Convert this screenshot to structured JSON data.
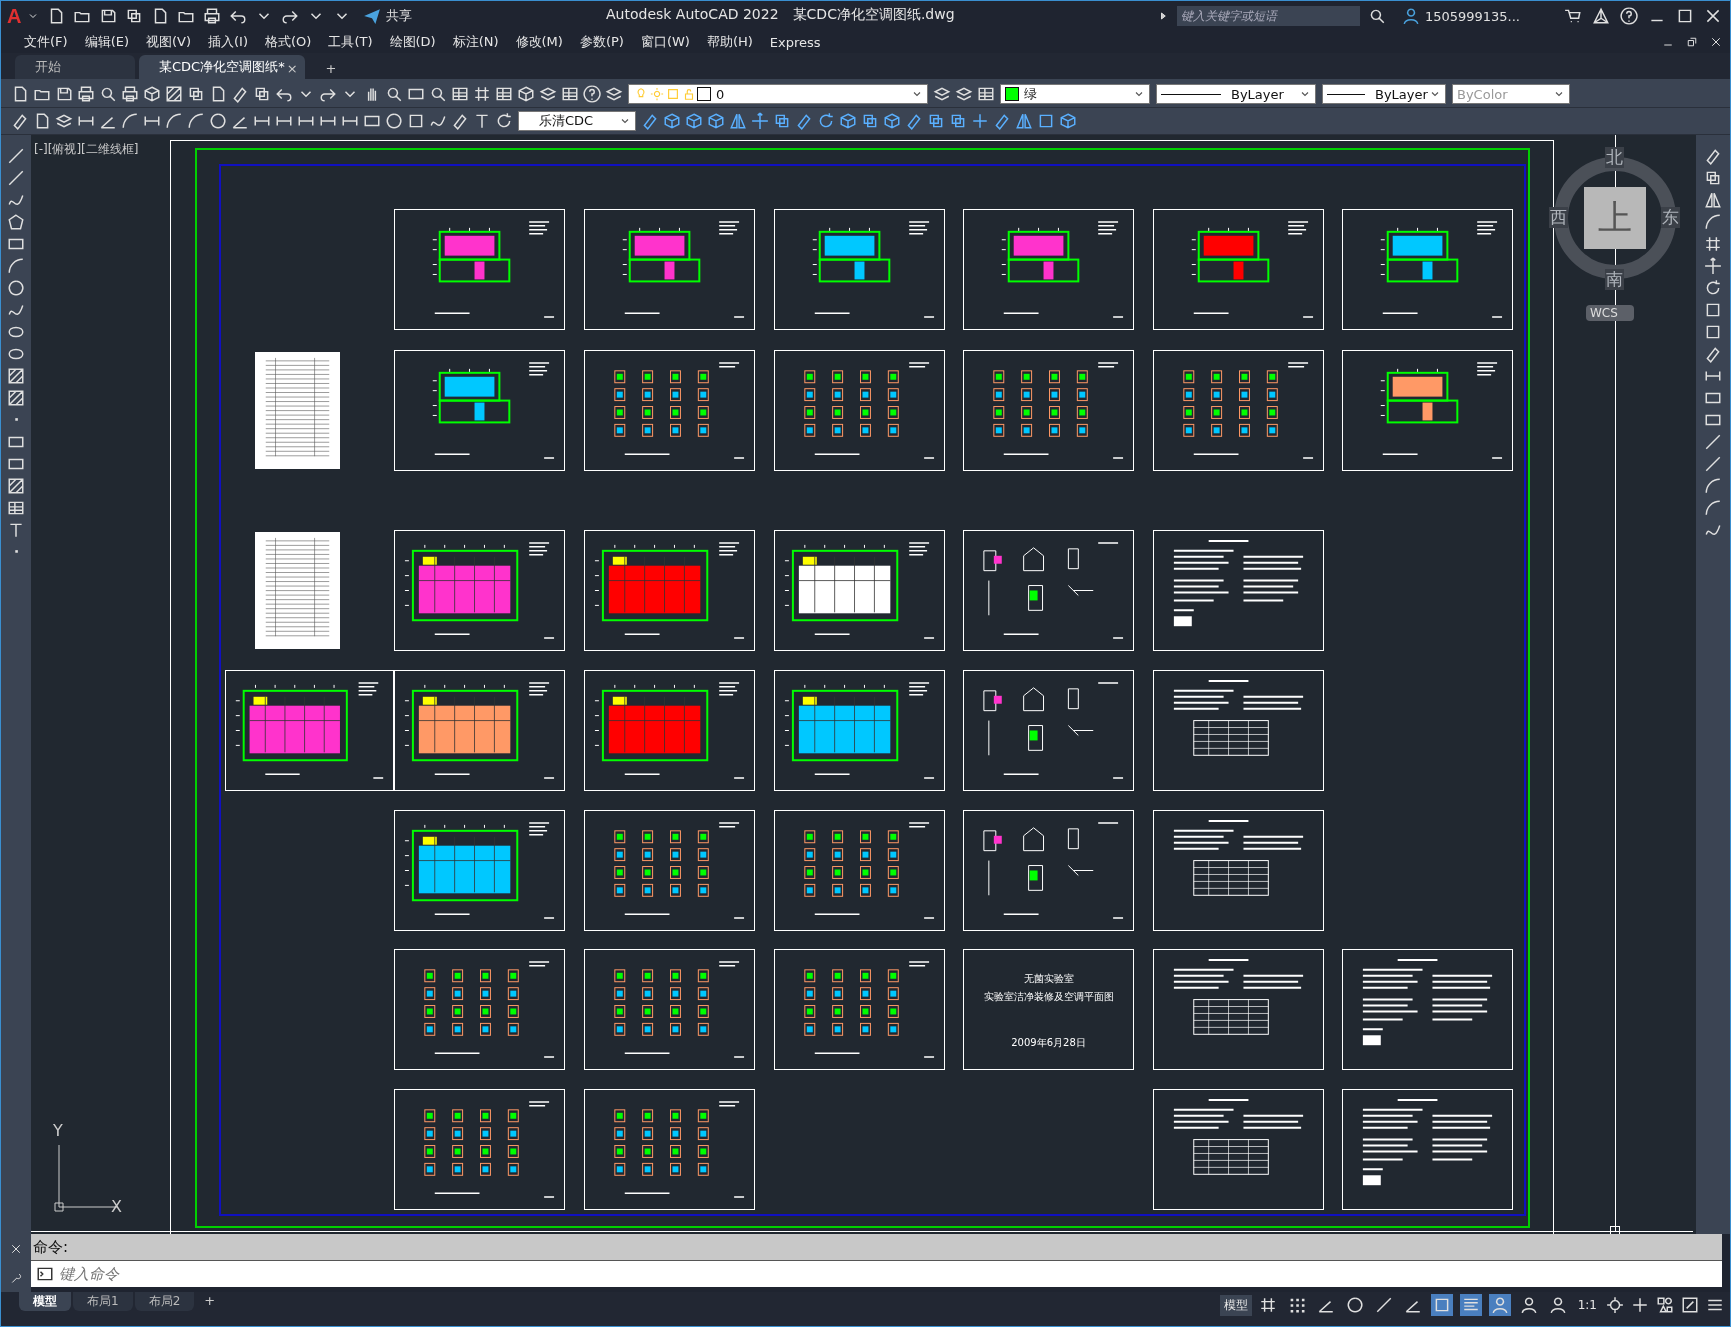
{
  "title_bar": {
    "logo": "A",
    "share": "共享",
    "app_title": "Autodesk AutoCAD 2022",
    "file_name": "某CDC净化空调图纸.dwg",
    "search": {
      "placeholder": "键入关键字或短语"
    },
    "user": "1505999135..."
  },
  "menu": [
    "文件(F)",
    "编辑(E)",
    "视图(V)",
    "插入(I)",
    "格式(O)",
    "工具(T)",
    "绘图(D)",
    "标注(N)",
    "修改(M)",
    "参数(P)",
    "窗口(W)",
    "帮助(H)",
    "Express"
  ],
  "doc_tabs": [
    {
      "label": "开始",
      "selected": false
    },
    {
      "label": "某CDC净化空调图纸*",
      "selected": true
    }
  ],
  "doc_tab_close": "×",
  "doc_tab_add": "+",
  "properties": {
    "layer": "0",
    "color": {
      "label": "绿",
      "color": "#00ff00"
    },
    "linetype": "ByLayer",
    "lineweight": "ByLayer",
    "plot_style": {
      "label": "ByColor",
      "disabled": true
    },
    "text_style": "乐清CDC"
  },
  "viewport": {
    "label": "[-][俯视][二维线框]",
    "compass": {
      "north": "北",
      "south": "南",
      "east": "东",
      "west": "西",
      "face": "上",
      "ucs": "WCS"
    },
    "ucs_icon": {
      "y": "Y",
      "x": "X"
    },
    "sheet_rows": [
      [
        {
          "kind": "gap"
        },
        {
          "kind": "plan",
          "color": "#ff33cc"
        },
        {
          "kind": "plan",
          "color": "#ff33cc"
        },
        {
          "kind": "plan",
          "color": "#00c8ff"
        },
        {
          "kind": "plan",
          "color": "#ff33cc"
        },
        {
          "kind": "plan",
          "color": "#ff0000"
        },
        {
          "kind": "plan",
          "color": "#00c8ff"
        }
      ],
      [
        {
          "kind": "list"
        },
        {
          "kind": "plan",
          "color": "#00c8ff"
        },
        {
          "kind": "detail-grid"
        },
        {
          "kind": "detail-grid"
        },
        {
          "kind": "detail-grid"
        },
        {
          "kind": "detail-grid"
        },
        {
          "kind": "plan",
          "color": "#ff9966"
        }
      ],
      [
        {
          "kind": "list"
        },
        {
          "kind": "plan-wide",
          "color": "#ff33cc"
        },
        {
          "kind": "plan-wide",
          "color": "#ff0000"
        },
        {
          "kind": "plan-wide",
          "color": "#ffffff"
        },
        {
          "kind": "detail"
        },
        {
          "kind": "text"
        },
        {
          "kind": "gap"
        }
      ],
      [
        {
          "kind": "plan-wide",
          "color": "#ff33cc"
        },
        {
          "kind": "plan-wide",
          "color": "#ff9966"
        },
        {
          "kind": "plan-wide",
          "color": "#ff0000"
        },
        {
          "kind": "plan-wide",
          "color": "#00c8ff"
        },
        {
          "kind": "detail"
        },
        {
          "kind": "table"
        },
        {
          "kind": "gap"
        }
      ],
      [
        {
          "kind": "gap"
        },
        {
          "kind": "plan-wide",
          "color": "#00c8ff"
        },
        {
          "kind": "detail-grid"
        },
        {
          "kind": "detail-grid"
        },
        {
          "kind": "detail"
        },
        {
          "kind": "table"
        },
        {
          "kind": "gap"
        }
      ],
      [
        {
          "kind": "gap"
        },
        {
          "kind": "detail-grid"
        },
        {
          "kind": "detail-grid"
        },
        {
          "kind": "detail-grid"
        },
        {
          "kind": "cover",
          "lines": [
            "无菌实验室",
            "实验室洁净装修及空调平面图",
            "2009年6月28日"
          ]
        },
        {
          "kind": "table"
        },
        {
          "kind": "text"
        }
      ],
      [
        {
          "kind": "gap"
        },
        {
          "kind": "detail-grid"
        },
        {
          "kind": "detail-grid"
        },
        {
          "kind": "gap"
        },
        {
          "kind": "gap"
        },
        {
          "kind": "table"
        },
        {
          "kind": "text"
        }
      ]
    ]
  },
  "command": {
    "history": "命令:",
    "placeholder": "键入命令"
  },
  "layout_tabs": [
    {
      "label": "模型",
      "selected": true
    },
    {
      "label": "布局1",
      "selected": false
    },
    {
      "label": "布局2",
      "selected": false
    }
  ],
  "layout_tab_add": "+",
  "status_bar": {
    "space": "模型",
    "toggles": [
      {
        "kind": "grid",
        "on": false
      },
      {
        "kind": "snap",
        "on": false
      },
      {
        "kind": "ortho",
        "on": false
      },
      {
        "kind": "polar",
        "on": false
      },
      {
        "kind": "osnap-track",
        "on": false
      },
      {
        "kind": "angle",
        "on": false
      },
      {
        "kind": "osnap",
        "on": true
      },
      {
        "kind": "lineweight",
        "on": true
      },
      {
        "kind": "annotation",
        "on": true
      },
      {
        "kind": "annotation-scale",
        "on": false
      },
      {
        "kind": "annotation-auto",
        "on": false
      }
    ],
    "scale": "1:1"
  }
}
